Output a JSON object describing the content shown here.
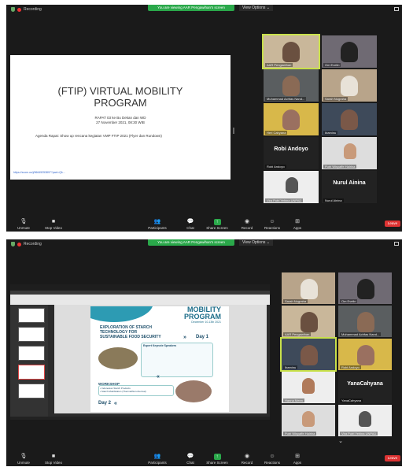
{
  "top": {
    "recording": "Recording",
    "banner": "You are viewing AAR Pengawihan's screen",
    "view_options": "View Options ⌄"
  },
  "slide": {
    "title_line1": "(FTIP) VIRTUAL MOBILITY",
    "title_line2": "PROGRAM",
    "sub1": "RAPAT 03 ke Bu Dekan dan WD",
    "sub2": "27 November 2021, 08:30 WIB",
    "agenda": "Agenda Rapat: Show up rencana kegiatan VMP FTIP 2021 (Flyer dan Rundown)",
    "link": "https://zoom.us/j/96645253897?pwd=Qk..."
  },
  "participants_top": [
    "AAR Pengawihan",
    "Om Evelin",
    "Muhammad Achfas Nand...",
    "Sarah Nugraha",
    "Heri Cahyana",
    "Ibaminu",
    "Robi Andoyo",
    "Putri Wisyaffe Hairina",
    "Vira Putri Yehina UNPAD",
    "Nurul Ainina"
  ],
  "big_names_top": {
    "robi": "Robi Andoyo",
    "nurul": "Nurul Ainina"
  },
  "participants_bottom": [
    "Sarah Nugraha",
    "Om Evelin",
    "AAR Pengawihan",
    "Muhammad Achfas Nand...",
    "Ibaminu",
    "Robi Andoyo",
    "Hanna Menn",
    "YanaCahyana",
    "Putri Wisyaffe Hairina",
    "Vira Putri Yehina UNPAD"
  ],
  "big_names_bottom": {
    "yana": "YanaCahyana"
  },
  "toolbar": {
    "unmute": "Unmute",
    "stop_video": "Stop Video",
    "participants": "Participants",
    "chat": "Chat",
    "share_screen": "Share Screen",
    "record": "Record",
    "reactions": "Reactions",
    "apps": "Apps",
    "leave": "Leave",
    "participants_count": "11"
  },
  "poster": {
    "head1": "MOBILITY",
    "head2": "PROGRAM",
    "date": "December 10-13th 2021",
    "h1": "EXPLORATION OF STARCH TECHNOLOGY FOR SUSTAINABLE FOOD SECURITY",
    "speakers": "Expert Keynote Speakers",
    "day1": "Day 1",
    "workshop": "WORKSHOP",
    "ws1": "• Indonesian Starch Products",
    "ws2": "• Starch Modification (Thermal/Non-thermal)",
    "day2": "Day 2"
  }
}
